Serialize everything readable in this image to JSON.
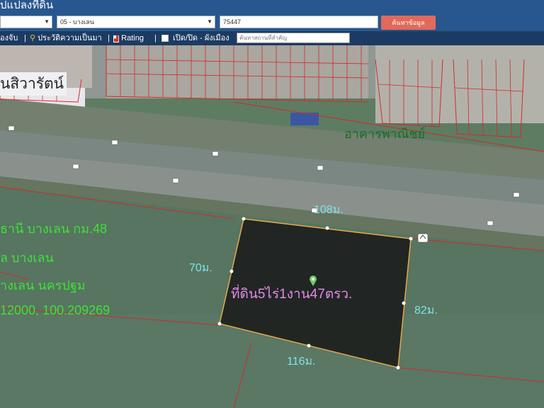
{
  "header": {
    "title": "ปแปลงที่ดิน",
    "province_select": "",
    "district_select": "05 - บางเลน",
    "parcel_input": "75447",
    "search_button": "ค้นหาข้อมูล"
  },
  "toolbar": {
    "item1": "องจับ",
    "item2": "ประวัติความเป็นมา",
    "item3": "Rating",
    "item4": "เปิด/ปิด - ผังเมือง",
    "landmark_placeholder": "ค้นหาสถานที่สำคัญ"
  },
  "map": {
    "labels": {
      "road_name": "นสิวารัตน์",
      "commercial": "อาคารพาณิชย์",
      "land_area": "ที่ดิน5ไร่1งาน47ตรว.",
      "dim_top": "108ม.",
      "dim_left": "70ม.",
      "dim_right": "82ม.",
      "dim_bottom": "116ม.",
      "info_line1": "ธานี บางเลน กม.48",
      "info_line2": "ล บางเลน",
      "info_line3": "างเลน นครปฐม",
      "info_line4": "12000, 100.209269"
    },
    "colors": {
      "parcel_outline": "#e6a94a",
      "parcel_fill": "#1a1a1a",
      "dim_text": "#7fe3e6",
      "info_text": "#3fe03a",
      "area_text": "#e08ae6",
      "commercial_text": "#1e6b2a",
      "boundary_lines": "#d42a2a"
    },
    "icons": [
      "pin-icon",
      "route-shield-icon"
    ]
  }
}
